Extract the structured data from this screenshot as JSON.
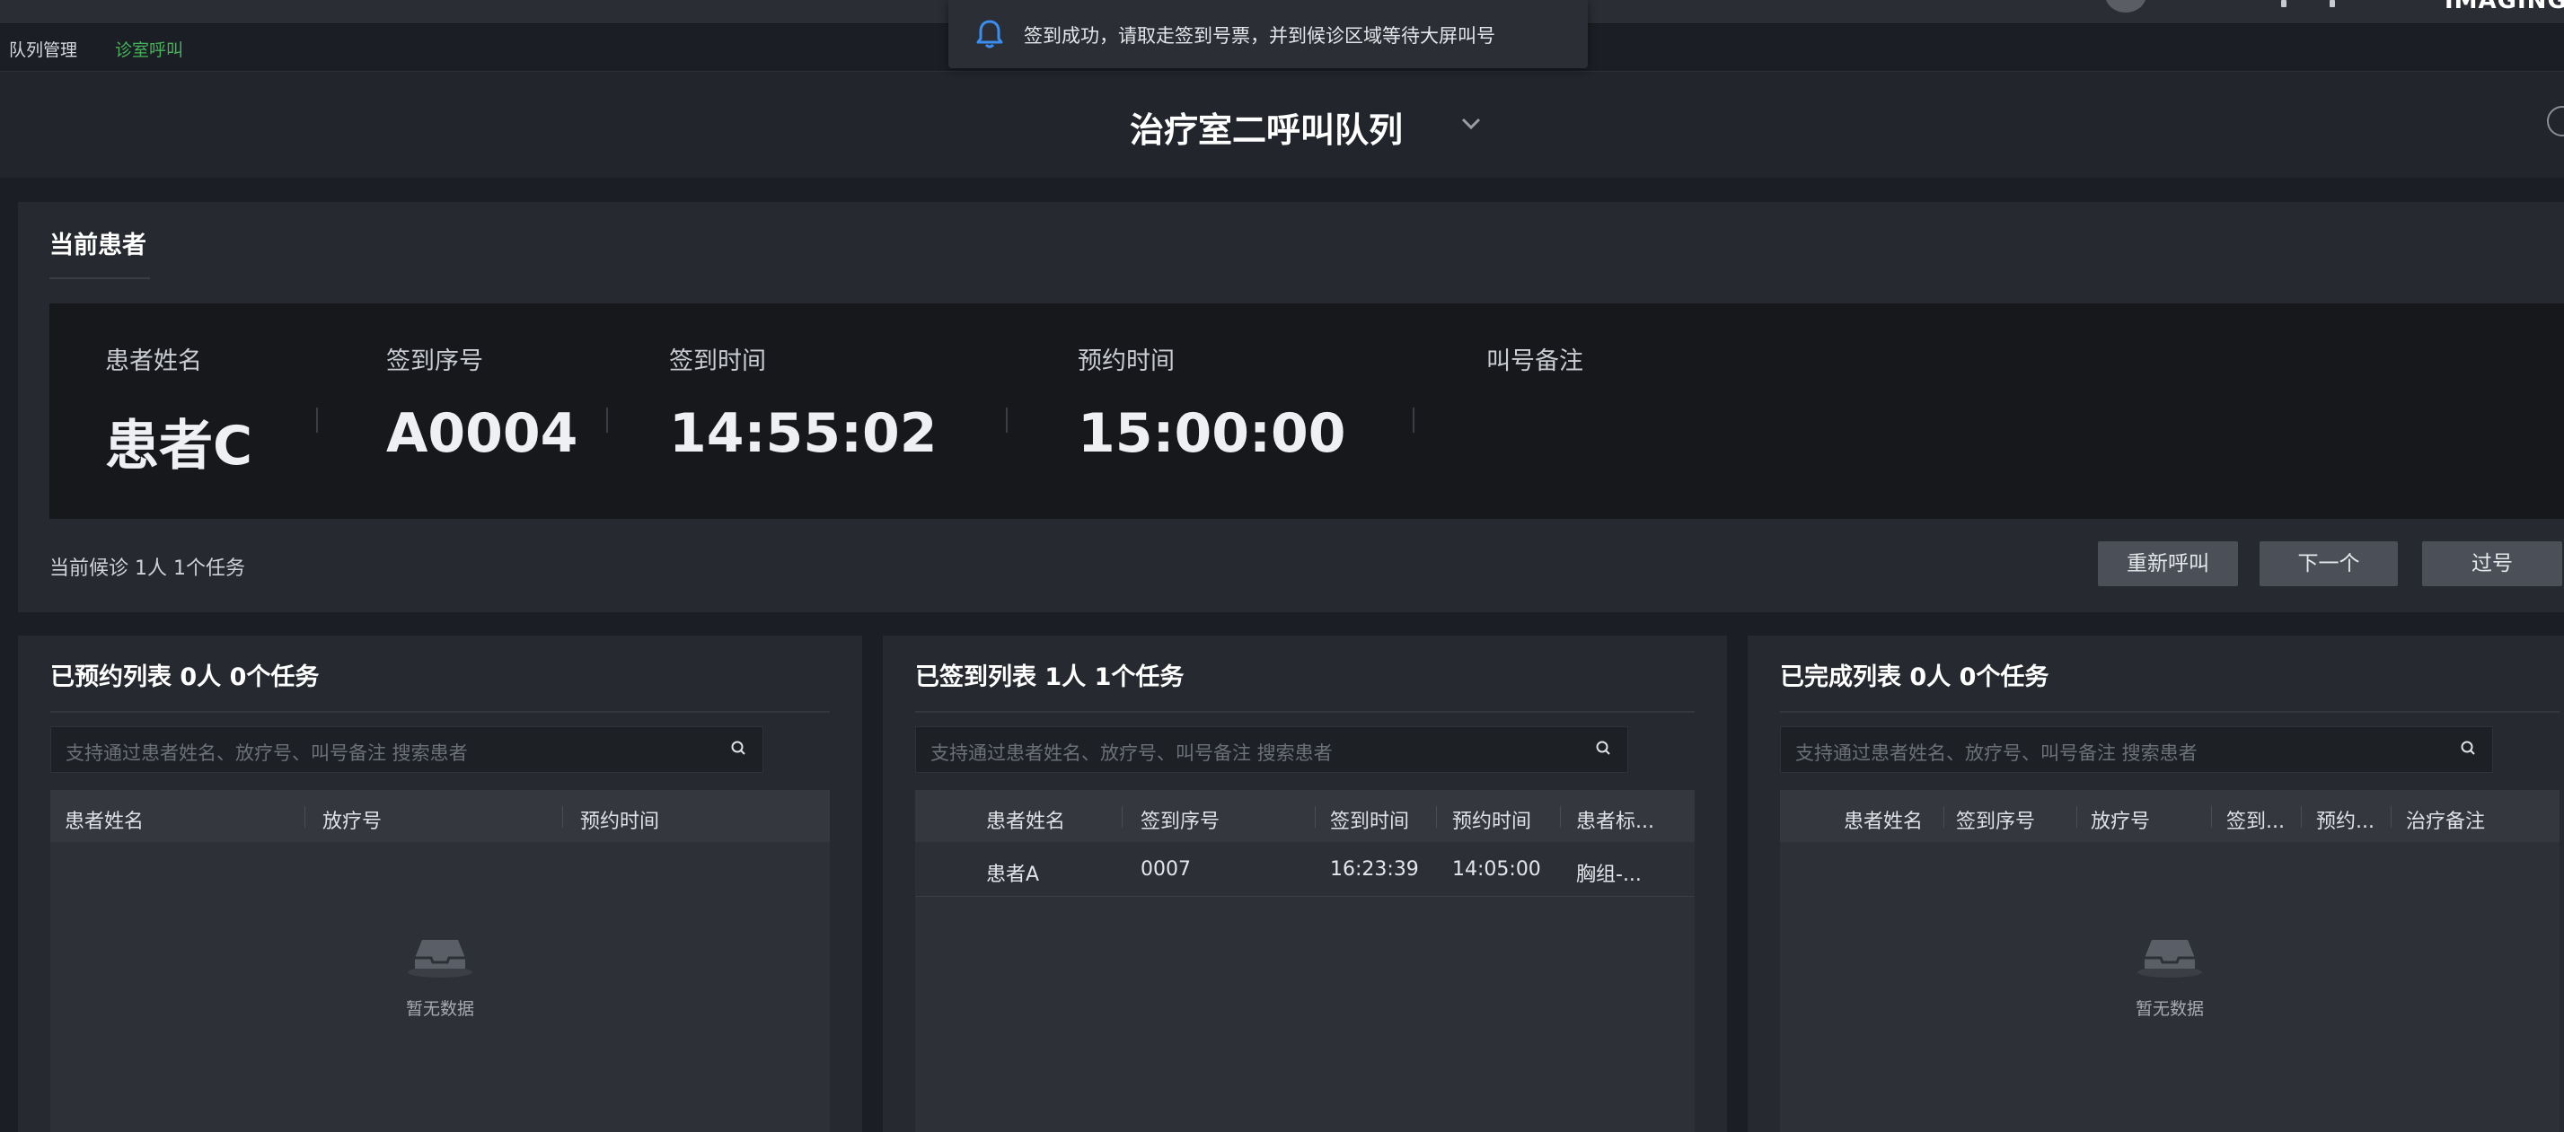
{
  "topbar": {
    "brand": "IMAGING"
  },
  "tabs": [
    {
      "label": "队列管理",
      "active": false
    },
    {
      "label": "诊室呼叫",
      "active": true
    }
  ],
  "notification": {
    "message": "签到成功，请取走签到号票，并到候诊区域等待大屏叫号",
    "icon": "bell-icon"
  },
  "header": {
    "title": "治疗室二呼叫队列"
  },
  "current": {
    "title": "当前患者",
    "fields": [
      {
        "label": "患者姓名",
        "value": "患者C"
      },
      {
        "label": "签到序号",
        "value": "A0004"
      },
      {
        "label": "签到时间",
        "value": "14:55:02"
      },
      {
        "label": "预约时间",
        "value": "15:00:00"
      },
      {
        "label": "叫号备注",
        "value": ""
      }
    ],
    "waiting": "当前候诊 1人 1个任务",
    "buttons": {
      "recall": "重新呼叫",
      "next": "下一个",
      "skip": "过号"
    }
  },
  "lists": {
    "reserved": {
      "title": "已预约列表 0人 0个任务",
      "placeholder": "支持通过患者姓名、放疗号、叫号备注 搜索患者",
      "columns": [
        "患者姓名",
        "放疗号",
        "预约时间"
      ],
      "empty_text": "暂无数据"
    },
    "checked_in": {
      "title": "已签到列表 1人 1个任务",
      "placeholder": "支持通过患者姓名、放疗号、叫号备注 搜索患者",
      "columns": [
        "患者姓名",
        "签到序号",
        "签到时间",
        "预约时间",
        "患者标..."
      ],
      "rows": [
        [
          "患者A",
          "0007",
          "16:23:39",
          "14:05:00",
          "胸组-..."
        ]
      ]
    },
    "completed": {
      "title": "已完成列表 0人 0个任务",
      "placeholder": "支持通过患者姓名、放疗号、叫号备注 搜索患者",
      "columns": [
        "患者姓名",
        "签到序号",
        "放疗号",
        "签到...",
        "预约...",
        "治疗备注"
      ],
      "empty_text": "暂无数据"
    }
  },
  "colors": {
    "accent": "#46b35b",
    "notify_bell": "#3a8ef0"
  }
}
